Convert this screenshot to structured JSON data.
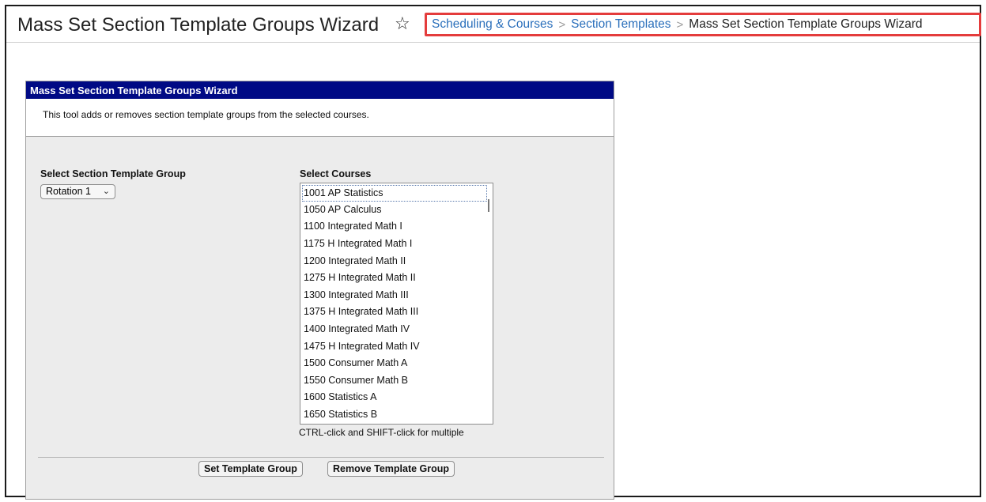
{
  "header": {
    "title": "Mass Set Section Template Groups Wizard",
    "breadcrumb": {
      "item1": "Scheduling & Courses",
      "item2": "Section Templates",
      "current": "Mass Set Section Template Groups Wizard",
      "separator": ">"
    },
    "star_icon": "☆"
  },
  "wizard": {
    "title": "Mass Set Section Template Groups Wizard",
    "description": "This tool adds or removes section template groups from the selected courses.",
    "template_group_label": "Select Section Template Group",
    "template_group_value": "Rotation 1",
    "courses_label": "Select Courses",
    "courses": [
      "1001 AP Statistics",
      "1050 AP Calculus",
      "1100 Integrated Math I",
      "1175 H Integrated Math I",
      "1200 Integrated Math II",
      "1275 H Integrated Math II",
      "1300 Integrated Math III",
      "1375 H Integrated Math III",
      "1400 Integrated Math IV",
      "1475 H Integrated Math IV",
      "1500 Consumer Math A",
      "1550 Consumer Math B",
      "1600 Statistics A",
      "1650 Statistics B"
    ],
    "hint": "CTRL-click and SHIFT-click for multiple",
    "set_button": "Set Template Group",
    "remove_button": "Remove Template Group"
  },
  "colors": {
    "titlebar": "#000a85",
    "breadcrumb_highlight": "#e43c3c",
    "link": "#2a6fbb"
  }
}
